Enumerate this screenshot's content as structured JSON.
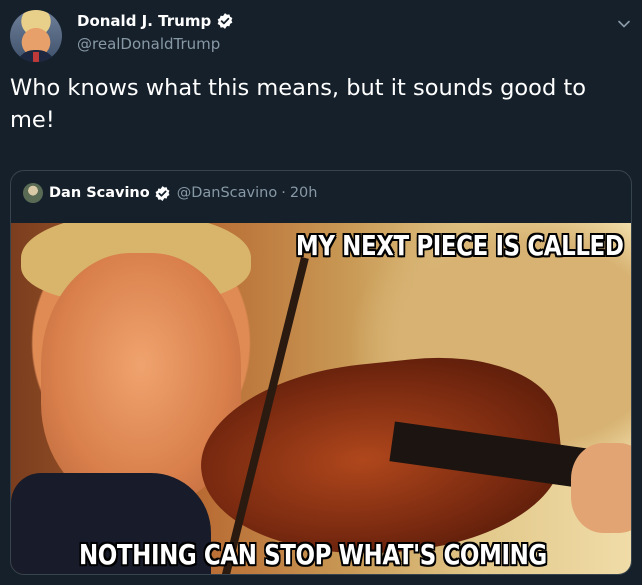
{
  "author": {
    "display_name": "Donald J. Trump",
    "handle": "@realDonaldTrump"
  },
  "tweet": {
    "text": "Who knows what this means, but it sounds good to me!"
  },
  "quoted_tweet": {
    "display_name": "Dan Scavino",
    "handle": "@DanScavino",
    "separator": "·",
    "time": "20h",
    "image": {
      "top_caption": "MY NEXT PIECE IS CALLED",
      "bottom_caption": "NOTHING CAN STOP WHAT'S COMING"
    }
  },
  "colors": {
    "background": "#15202b",
    "secondary_text": "#8899a6",
    "verified_blue": "#ffffff",
    "border": "#38444d"
  },
  "icons": {
    "verified": "verified-badge-icon",
    "menu": "chevron-down-icon"
  }
}
